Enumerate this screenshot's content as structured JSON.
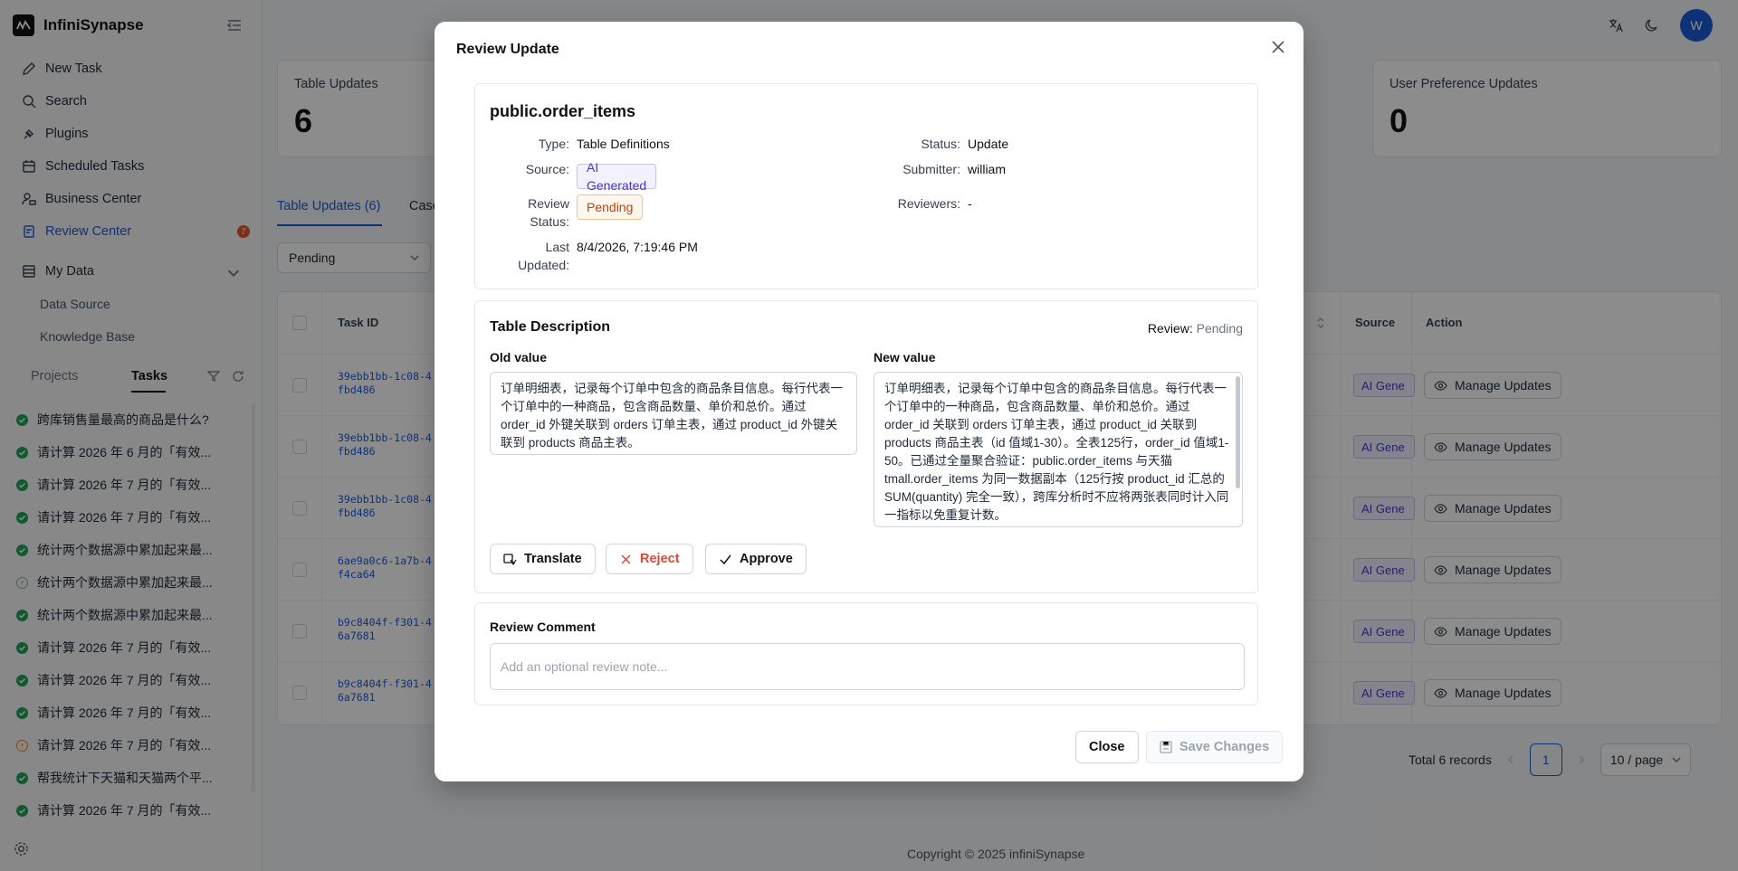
{
  "app": {
    "name": "InfiniSynapse"
  },
  "sidebar": {
    "nav": [
      {
        "label": "New Task",
        "icon": "edit-icon"
      },
      {
        "label": "Search",
        "icon": "search-icon"
      },
      {
        "label": "Plugins",
        "icon": "plugin-icon"
      },
      {
        "label": "Scheduled Tasks",
        "icon": "calendar-icon"
      },
      {
        "label": "Business Center",
        "icon": "business-icon"
      },
      {
        "label": "Review Center",
        "icon": "review-icon",
        "badge": "7"
      }
    ],
    "my_data": {
      "label": "My Data",
      "items": [
        "Data Source",
        "Knowledge Base"
      ]
    },
    "tabs": {
      "projects": "Projects",
      "tasks": "Tasks"
    },
    "tasks": [
      {
        "title": "跨库销售量最高的商品是什么?",
        "status": "done"
      },
      {
        "title": "请计算 2026 年 6 月的「有效...",
        "status": "done"
      },
      {
        "title": "请计算 2026 年 7 月的「有效...",
        "status": "done"
      },
      {
        "title": "请计算 2026 年 7 月的「有效...",
        "status": "done"
      },
      {
        "title": "统计两个数据源中累加起来最...",
        "status": "done"
      },
      {
        "title": "统计两个数据源中累加起来最...",
        "status": "info"
      },
      {
        "title": "统计两个数据源中累加起来最...",
        "status": "done"
      },
      {
        "title": "请计算 2026 年 7 月的「有效...",
        "status": "done"
      },
      {
        "title": "请计算 2026 年 7 月的「有效...",
        "status": "done"
      },
      {
        "title": "请计算 2026 年 7 月的「有效...",
        "status": "done"
      },
      {
        "title": "请计算 2026 年 7 月的「有效...",
        "status": "warn"
      },
      {
        "title": "帮我统计下天猫和天猫两个平...",
        "status": "done"
      },
      {
        "title": "请计算 2026 年 7 月的「有效...",
        "status": "done"
      }
    ]
  },
  "header": {
    "avatar_initial": "W"
  },
  "main": {
    "cards": [
      {
        "label": "Table Updates",
        "value": "6"
      },
      {
        "label": "User Preference Updates",
        "value": "0"
      }
    ],
    "tabs": [
      {
        "label": "Table Updates (6)"
      },
      {
        "label": "Case"
      }
    ],
    "filter_value": "Pending",
    "table": {
      "headers": {
        "task_id": "Task ID",
        "source": "Source",
        "action": "Action"
      },
      "rows": [
        {
          "task_id_1": "39ebb1bb-1c08-4",
          "task_id_2": "fbd486",
          "source": "AI Gene",
          "action": "Manage Updates"
        },
        {
          "task_id_1": "39ebb1bb-1c08-4",
          "task_id_2": "fbd486",
          "source": "AI Gene",
          "action": "Manage Updates"
        },
        {
          "task_id_1": "39ebb1bb-1c08-4",
          "task_id_2": "fbd486",
          "source": "AI Gene",
          "action": "Manage Updates"
        },
        {
          "task_id_1": "6ae9a0c6-1a7b-4",
          "task_id_2": "f4ca64",
          "source": "AI Gene",
          "action": "Manage Updates"
        },
        {
          "task_id_1": "b9c8404f-f301-4",
          "task_id_2": "6a7681",
          "source": "AI Gene",
          "action": "Manage Updates"
        },
        {
          "task_id_1": "b9c8404f-f301-4",
          "task_id_2": "6a7681",
          "source": "AI Gene",
          "action": "Manage Updates"
        }
      ]
    },
    "pager": {
      "total": "Total 6 records",
      "page": "1",
      "page_size": "10 / page"
    },
    "copyright": "Copyright © 2025 infiniSynapse"
  },
  "modal": {
    "title": "Review Update",
    "table_name": "public.order_items",
    "fields": {
      "type_k": "Type:",
      "type_v": "Table Definitions",
      "source_k": "Source:",
      "source_v": "AI Generated",
      "review_status_k1": "Review",
      "review_status_k2": "Status:",
      "review_status_v": "Pending",
      "last_updated_k1": "Last",
      "last_updated_k2": "Updated:",
      "last_updated_v": "8/4/2026, 7:19:46 PM",
      "status_k": "Status:",
      "status_v": "Update",
      "submitter_k": "Submitter:",
      "submitter_v": "william",
      "reviewers_k": "Reviewers:",
      "reviewers_v": "-"
    },
    "description": {
      "title": "Table Description",
      "review_k": "Review:",
      "review_v": "Pending",
      "old_label": "Old value",
      "new_label": "New value",
      "old_value": "订单明细表，记录每个订单中包含的商品条目信息。每行代表一个订单中的一种商品，包含商品数量、单价和总价。通过 order_id 外键关联到 orders 订单主表，通过 product_id 外键关联到 products 商品主表。",
      "new_value": "订单明细表，记录每个订单中包含的商品条目信息。每行代表一个订单中的一种商品，包含商品数量、单价和总价。通过 order_id 关联到 orders 订单主表，通过 product_id 关联到 products 商品主表（id 值域1-30）。全表125行，order_id 值域1-50。已通过全量聚合验证：public.order_items 与天猫 tmall.order_items 为同一数据副本（125行按 product_id 汇总的 SUM(quantity) 完全一致），跨库分析时不应将两张表同时计入同一指标以免重复计数。",
      "translate": "Translate",
      "reject": "Reject",
      "approve": "Approve"
    },
    "comment": {
      "label": "Review Comment",
      "placeholder": "Add an optional review note..."
    },
    "footer": {
      "close": "Close",
      "save": "Save Changes"
    }
  }
}
